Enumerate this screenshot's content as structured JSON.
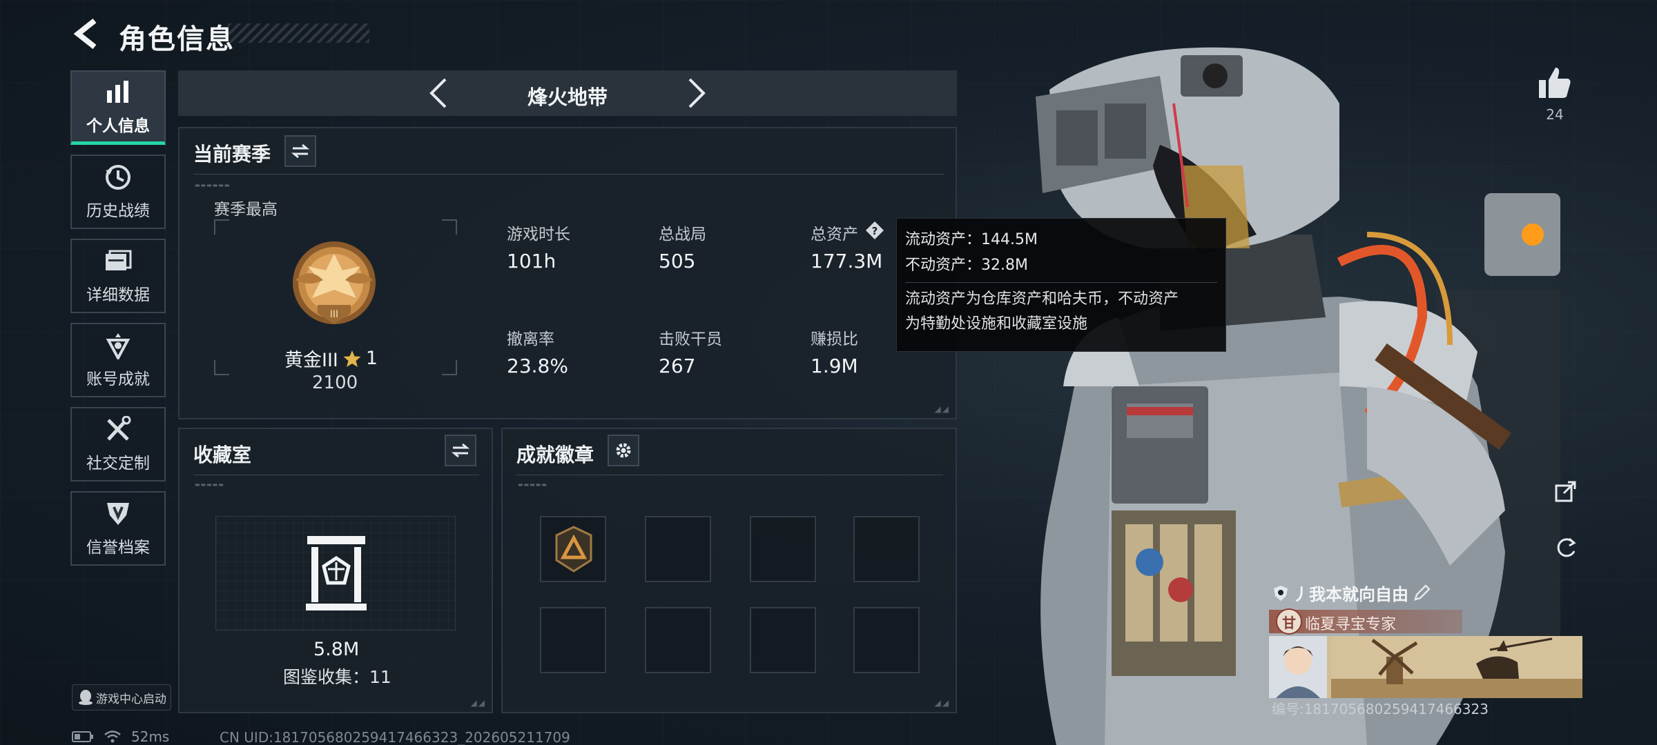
{
  "header": {
    "title": "角色信息"
  },
  "nav": {
    "items": [
      {
        "label": "个人信息",
        "icon": "bar-chart-icon",
        "active": true
      },
      {
        "label": "历史战绩",
        "icon": "history-icon",
        "active": false
      },
      {
        "label": "详细数据",
        "icon": "folder-icon",
        "active": false
      },
      {
        "label": "账号成就",
        "icon": "achievement-icon",
        "active": false
      },
      {
        "label": "社交定制",
        "icon": "tools-icon",
        "active": false
      },
      {
        "label": "信誉档案",
        "icon": "reputation-icon",
        "active": false
      }
    ],
    "launcher_badge": "游戏中心启动"
  },
  "mode": {
    "label": "烽火地带"
  },
  "season": {
    "title": "当前赛季",
    "best_label": "赛季最高",
    "rank_name": "黄金III",
    "rank_stars": "1",
    "rank_score": "2100",
    "stats": [
      {
        "label": "游戏时长",
        "value": "101h"
      },
      {
        "label": "总战局",
        "value": "505"
      },
      {
        "label": "总资产",
        "value": "177.3M"
      },
      {
        "label": "撤离率",
        "value": "23.8%"
      },
      {
        "label": "击败干员",
        "value": "267"
      },
      {
        "label": "赚损比",
        "value": "1.9M"
      }
    ]
  },
  "tooltip": {
    "line1": "流动资产：144.5M",
    "line2": "不动资产：32.8M",
    "desc1": "流动资产为仓库资产和哈夫币，不动资产",
    "desc2": "为特勤处设施和收藏室设施"
  },
  "collection": {
    "title": "收藏室",
    "value": "5.8M",
    "catalog": "图鉴收集：11"
  },
  "achievements": {
    "title": "成就徽章"
  },
  "right": {
    "likes": "24",
    "card": {
      "name": "丿我本就向自由",
      "title": "临夏寻宝专家",
      "seal_char": "甘",
      "id_text": "编号:181705680259417466323"
    }
  },
  "status": {
    "ping": "52ms",
    "uid": "CN UID:181705680259417466323_202605211709"
  },
  "colors": {
    "accent": "#26d6a6",
    "panel_bg": "#1a222a",
    "tooltip_bg": "#06080a"
  }
}
